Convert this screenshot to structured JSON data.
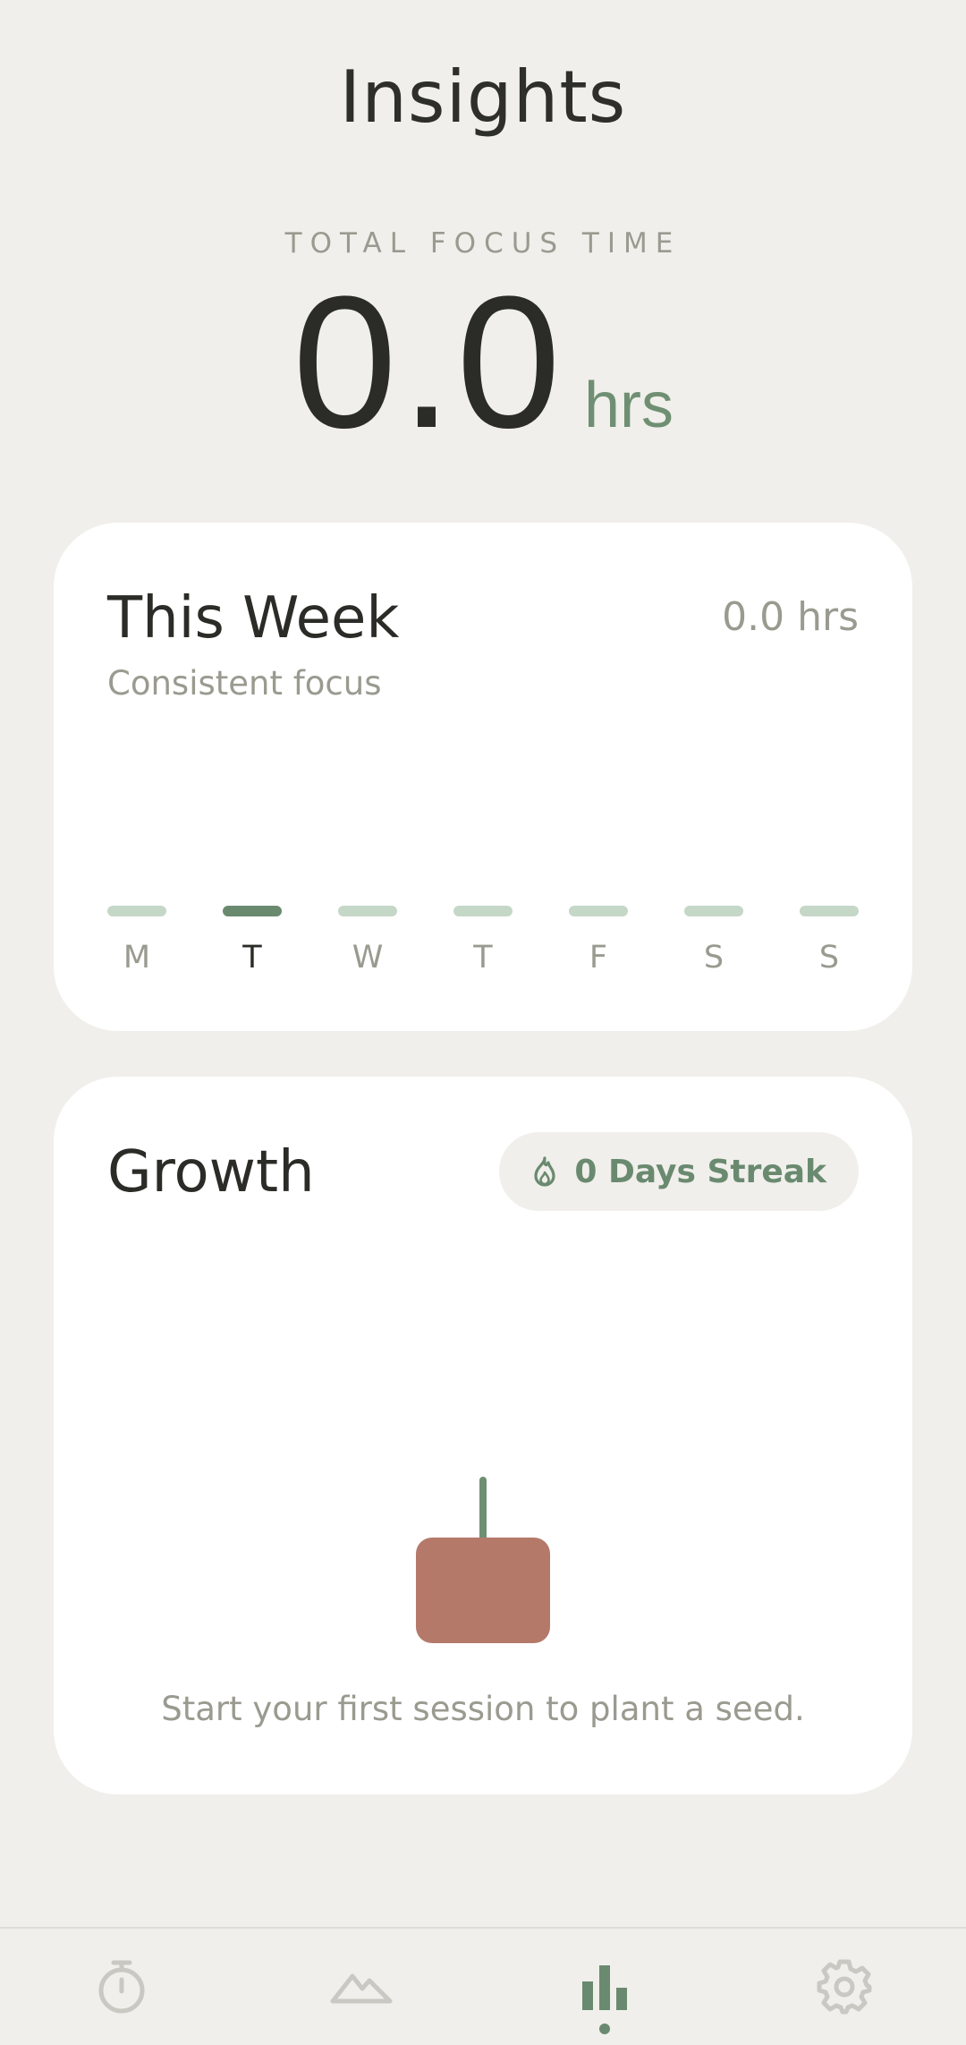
{
  "header": {
    "title": "Insights"
  },
  "total": {
    "label": "TOTAL FOCUS TIME",
    "value": "0.0",
    "unit": "hrs"
  },
  "week_card": {
    "title": "This Week",
    "subtitle": "Consistent focus",
    "total": "0.0 hrs",
    "days": [
      {
        "label": "M",
        "active": false
      },
      {
        "label": "T",
        "active": true
      },
      {
        "label": "W",
        "active": false
      },
      {
        "label": "T",
        "active": false
      },
      {
        "label": "F",
        "active": false
      },
      {
        "label": "S",
        "active": false
      },
      {
        "label": "S",
        "active": false
      }
    ]
  },
  "growth_card": {
    "title": "Growth",
    "streak": "0 Days Streak",
    "streak_icon": "flame-icon",
    "caption": "Start your first session to plant a seed."
  },
  "nav": {
    "items": [
      {
        "icon": "stopwatch-icon",
        "active": false
      },
      {
        "icon": "mountain-icon",
        "active": false
      },
      {
        "icon": "bar-chart-icon",
        "active": true
      },
      {
        "icon": "gear-icon",
        "active": false
      }
    ]
  },
  "colors": {
    "background": "#f0efeb",
    "accent": "#6a8a70",
    "bar_inactive": "#c5d7c7",
    "pot": "#b5796a"
  }
}
